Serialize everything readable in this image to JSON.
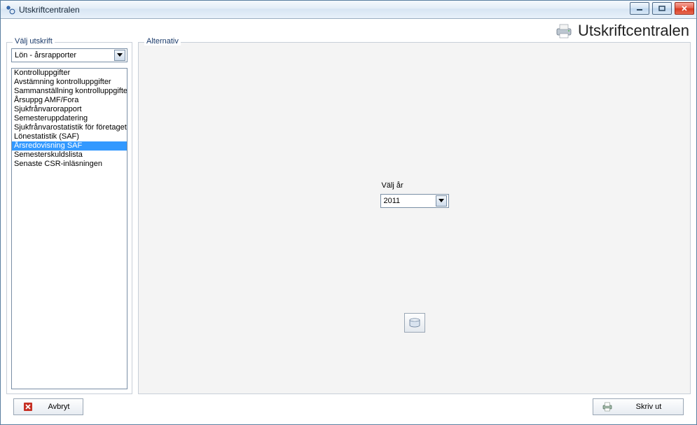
{
  "window": {
    "title": "Utskriftcentralen"
  },
  "banner": {
    "title": "Utskriftcentralen"
  },
  "left": {
    "legend": "Välj utskrift",
    "dropdown_value": "Lön - årsrapporter",
    "items": [
      "Kontrolluppgifter",
      "Avstämning kontrolluppgifter",
      "Sammanställning kontrolluppgifter",
      "Årsuppg AMF/Fora",
      "Sjukfrånvarorapport",
      "Semesteruppdatering",
      "Sjukfrånvarostatistik för företaget",
      "Lönestatistik (SAF)",
      "Årsredovisning SAF",
      "Semesterskuldslista",
      "Senaste CSR-inläsningen"
    ],
    "selected_index": 8
  },
  "right": {
    "legend": "Alternativ",
    "year_label": "Välj år",
    "year_value": "2011"
  },
  "buttons": {
    "cancel": "Avbryt",
    "print": "Skriv ut"
  }
}
